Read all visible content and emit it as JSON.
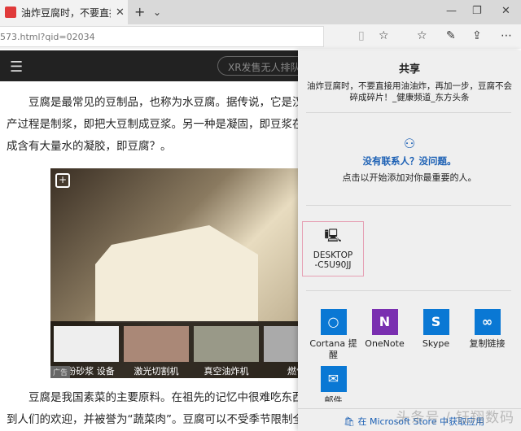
{
  "browser": {
    "tab_title": "油炸豆腐时，不要直接",
    "url": "573.html?qid=02034",
    "icons": [
      "new-tab",
      "tab-list",
      "reading-view",
      "favorite",
      "favorites-hub",
      "notes",
      "share",
      "more"
    ]
  },
  "site": {
    "search_placeholder": "XR发售无人排队"
  },
  "article": {
    "p1": [
      "　　豆腐是最常见的豆制品，也称为水豆腐。据传说，它是汉代淮",
      "产过程是制浆，即把大豆制成豆浆。另一种是凝固，即豆浆在热和",
      "成含有大量水的凝胶，即豆腐？。"
    ],
    "p2": [
      "　　豆腐是我国素菜的主要原料。在祖先的记忆中很难吃东西。约",
      "到人们的欢迎，并被誉为“蔬菜肉”。豆腐可以不受季节限制全年"
    ],
    "ads": [
      "干粉砂浆 设备",
      "激光切割机",
      "真空油炸机",
      "燃气"
    ],
    "ad_tag": "广告"
  },
  "share": {
    "title": "共享",
    "description": "油炸豆腐时，不要直接用油油炸，再加一步，豆腐不会碎成碎片！_健康频道_东方头条",
    "no_contacts": "没有联系人？没问题。",
    "no_contacts_hint": "点击以开始添加对你最重要的人。",
    "device": "DESKTOP-C5U90JJ",
    "apps": [
      {
        "label": "Cortana 提醒",
        "color": "#0a78d4"
      },
      {
        "label": "OneNote",
        "color": "#7a2fb0"
      },
      {
        "label": "Skype",
        "color": "#0a78d4"
      },
      {
        "label": "复制链接",
        "color": "#0a78d4"
      },
      {
        "label": "邮件",
        "color": "#0a78d4"
      }
    ],
    "store_link": "在 Microsoft Store 中获取应用"
  },
  "watermark": "头条号 / 钰翔数码"
}
